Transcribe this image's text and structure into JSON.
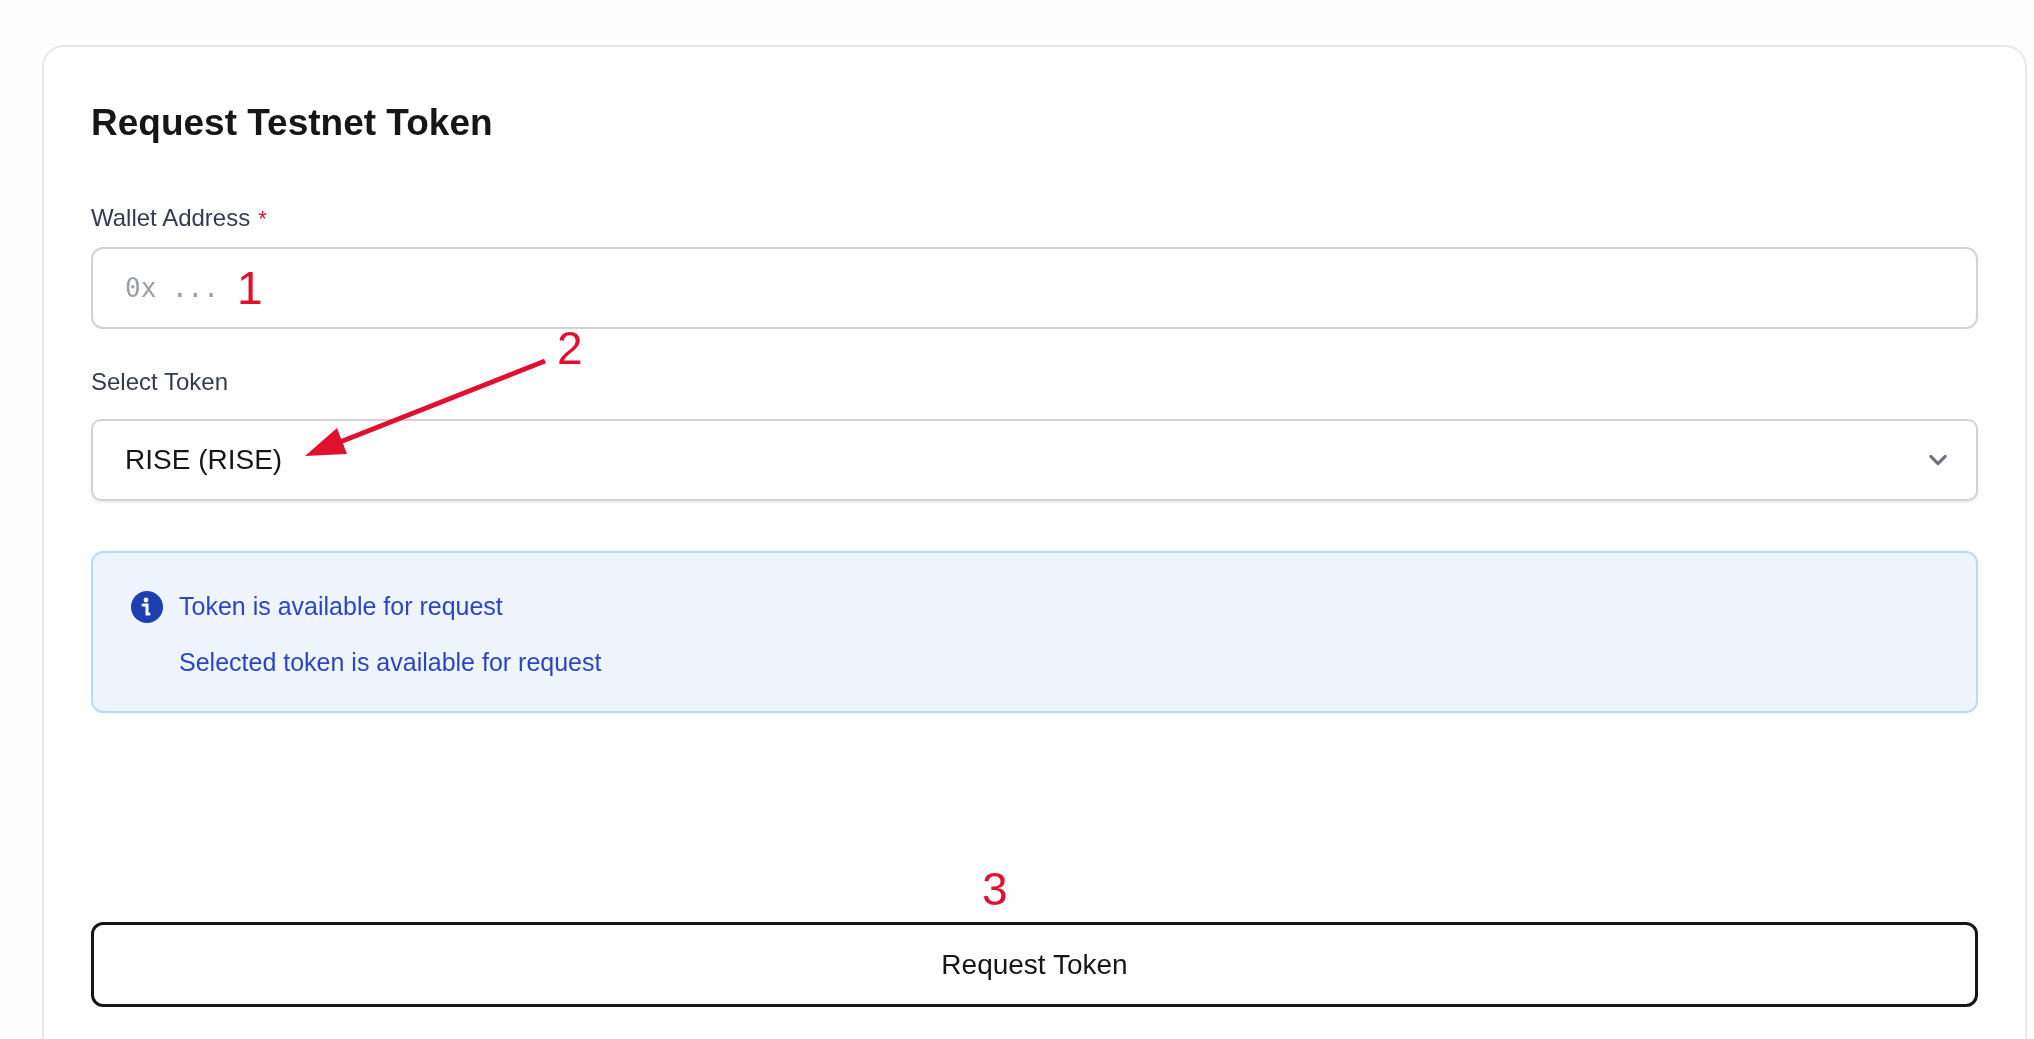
{
  "title": "Request Testnet Token",
  "wallet_address": {
    "label": "Wallet Address",
    "required_mark": "*",
    "placeholder": "0x ...",
    "annotation": "1"
  },
  "token_select": {
    "label": "Select Token",
    "value": "RISE (RISE)",
    "annotation": "2"
  },
  "alert": {
    "kind": "info",
    "title": "Token is available for request",
    "message": "Selected token is available for request"
  },
  "submit": {
    "label": "Request Token",
    "annotation": "3"
  }
}
